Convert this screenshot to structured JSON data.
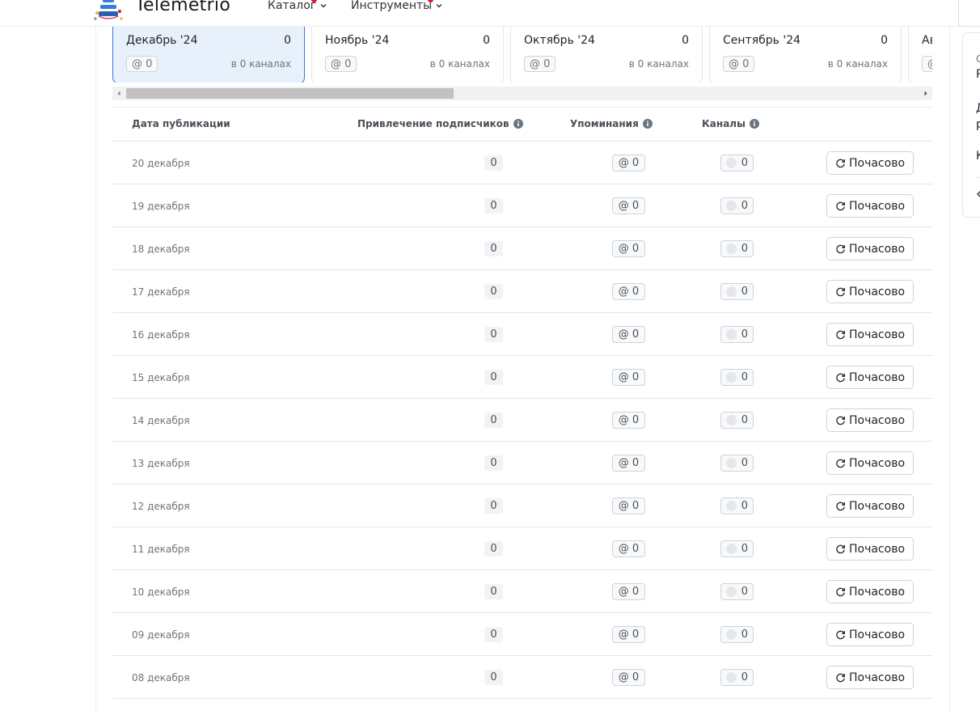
{
  "header": {
    "logo_text": "Telemetrio",
    "nav": [
      {
        "label": "Каталог"
      },
      {
        "label": "Инструменты"
      }
    ]
  },
  "months": [
    {
      "name": "Декабрь '24",
      "count": "0",
      "mentions": "@ 0",
      "channels": "в 0 каналах",
      "active": true
    },
    {
      "name": "Ноябрь '24",
      "count": "0",
      "mentions": "@ 0",
      "channels": "в 0 каналах"
    },
    {
      "name": "Октябрь '24",
      "count": "0",
      "mentions": "@ 0",
      "channels": "в 0 каналах"
    },
    {
      "name": "Сентябрь '24",
      "count": "0",
      "mentions": "@ 0",
      "channels": "в 0 каналах"
    },
    {
      "name": "Ав",
      "mentions": "@"
    }
  ],
  "table": {
    "columns": {
      "date": "Дата публикации",
      "subs": "Привлечение подписчиков",
      "mentions": "Упоминания",
      "channels": "Каналы"
    },
    "hourly_label": "Почасово",
    "rows": [
      {
        "date": "20 декабря",
        "subs": "0",
        "mentions": "@ 0",
        "channels": "0"
      },
      {
        "date": "19 декабря",
        "subs": "0",
        "mentions": "@ 0",
        "channels": "0"
      },
      {
        "date": "18 декабря",
        "subs": "0",
        "mentions": "@ 0",
        "channels": "0"
      },
      {
        "date": "17 декабря",
        "subs": "0",
        "mentions": "@ 0",
        "channels": "0"
      },
      {
        "date": "16 декабря",
        "subs": "0",
        "mentions": "@ 0",
        "channels": "0"
      },
      {
        "date": "15 декабря",
        "subs": "0",
        "mentions": "@ 0",
        "channels": "0"
      },
      {
        "date": "14 декабря",
        "subs": "0",
        "mentions": "@ 0",
        "channels": "0"
      },
      {
        "date": "13 декабря",
        "subs": "0",
        "mentions": "@ 0",
        "channels": "0"
      },
      {
        "date": "12 декабря",
        "subs": "0",
        "mentions": "@ 0",
        "channels": "0"
      },
      {
        "date": "11 декабря",
        "subs": "0",
        "mentions": "@ 0",
        "channels": "0"
      },
      {
        "date": "10 декабря",
        "subs": "0",
        "mentions": "@ 0",
        "channels": "0"
      },
      {
        "date": "09 декабря",
        "subs": "0",
        "mentions": "@ 0",
        "channels": "0"
      },
      {
        "date": "08 декабря",
        "subs": "0",
        "mentions": "@ 0",
        "channels": "0"
      }
    ]
  },
  "side_panel": {
    "lines": [
      "С",
      "Р",
      "Д",
      "р",
      "К"
    ]
  },
  "colors": {
    "accent": "#2a7fd4",
    "active_card_bg": "#e8f1fb",
    "notification_dot": "#e0142c"
  },
  "icons": [
    "logo-mascot-icon",
    "chevron-down-icon",
    "info-icon",
    "refresh-icon",
    "scroll-left-icon",
    "scroll-right-icon"
  ]
}
